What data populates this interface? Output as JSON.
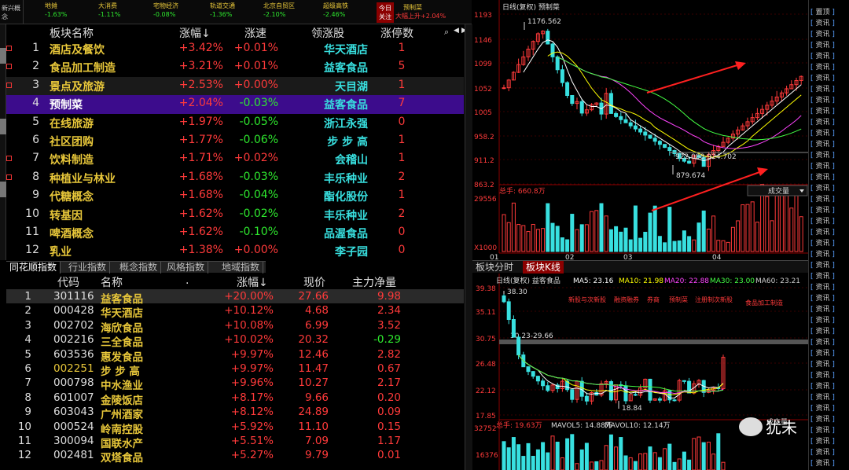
{
  "ticker": {
    "left_label": "新兴概念",
    "items": [
      {
        "name": "地摊",
        "value": "-1.63%",
        "dir": "dn"
      },
      {
        "name": "大消费",
        "value": "-1.11%",
        "dir": "dn"
      },
      {
        "name": "宅物经济",
        "value": "-0.08%",
        "dir": "dn"
      },
      {
        "name": "轨道交通",
        "value": "-1.36%",
        "dir": "dn"
      },
      {
        "name": "北京自贸区",
        "value": "-2.10%",
        "dir": "dn"
      },
      {
        "name": "超级高铁",
        "value": "-2.46%",
        "dir": "dn"
      },
      {
        "name": "预制菜",
        "value": "+2.04%",
        "dir": "up"
      }
    ],
    "today_label": "今日关注",
    "today_sub": "大幅上升"
  },
  "sector_table": {
    "headers": {
      "name": "板块名称",
      "pct": "涨幅↓",
      "speed": "涨速",
      "leader": "领涨股",
      "limit_up": "涨停数"
    },
    "rows": [
      {
        "no": "1",
        "name": "酒店及餐饮",
        "pct": "+3.42%",
        "speed": "+0.01%",
        "leader": "华天酒店",
        "limit_up": "1",
        "mark": true
      },
      {
        "no": "2",
        "name": "食品加工制造",
        "pct": "+3.21%",
        "speed": "+0.01%",
        "leader": "益客食品",
        "limit_up": "5",
        "mark": true
      },
      {
        "no": "3",
        "name": "景点及旅游",
        "pct": "+2.53%",
        "speed": "+0.00%",
        "leader": "天目湖",
        "limit_up": "1",
        "mark": true
      },
      {
        "no": "4",
        "name": "预制菜",
        "pct": "+2.04%",
        "speed": "-0.03%",
        "leader": "益客食品",
        "limit_up": "7",
        "mark": false
      },
      {
        "no": "5",
        "name": "在线旅游",
        "pct": "+1.97%",
        "speed": "-0.05%",
        "leader": "浙江永强",
        "limit_up": "0",
        "mark": false
      },
      {
        "no": "6",
        "name": "社区团购",
        "pct": "+1.77%",
        "speed": "-0.06%",
        "leader": "步 步 高",
        "limit_up": "1",
        "mark": false
      },
      {
        "no": "7",
        "name": "饮料制造",
        "pct": "+1.71%",
        "speed": "+0.02%",
        "leader": "会稽山",
        "limit_up": "1",
        "mark": true
      },
      {
        "no": "8",
        "name": "种植业与林业",
        "pct": "+1.68%",
        "speed": "-0.03%",
        "leader": "丰乐种业",
        "limit_up": "2",
        "mark": true
      },
      {
        "no": "9",
        "name": "代糖概念",
        "pct": "+1.68%",
        "speed": "-0.04%",
        "leader": "酯化股份",
        "limit_up": "1",
        "mark": false
      },
      {
        "no": "10",
        "name": "转基因",
        "pct": "+1.62%",
        "speed": "-0.02%",
        "leader": "丰乐种业",
        "limit_up": "2",
        "mark": false
      },
      {
        "no": "11",
        "name": "啤酒概念",
        "pct": "+1.62%",
        "speed": "-0.10%",
        "leader": "品渥食品",
        "limit_up": "0",
        "mark": false
      },
      {
        "no": "12",
        "name": "乳业",
        "pct": "+1.38%",
        "speed": "+0.00%",
        "leader": "李子园",
        "limit_up": "0",
        "mark": false
      }
    ]
  },
  "tabs": [
    "同花顺指数",
    "行业指数",
    "概念指数",
    "风格指数",
    "地域指数"
  ],
  "stock_table": {
    "headers": {
      "code": "代码",
      "name": "名称",
      "dot": ".",
      "pct": "涨幅↓",
      "price": "现价",
      "net": "主力净量"
    },
    "rows": [
      {
        "no": "1",
        "code": "301116",
        "name": "益客食品",
        "pct": "+20.00%",
        "price": "27.66",
        "net": "9.98",
        "net_dir": "up",
        "code_hl": false
      },
      {
        "no": "2",
        "code": "000428",
        "name": "华天酒店",
        "pct": "+10.12%",
        "price": "4.68",
        "net": "2.34",
        "net_dir": "up",
        "code_hl": false
      },
      {
        "no": "3",
        "code": "002702",
        "name": "海欣食品",
        "pct": "+10.08%",
        "price": "6.99",
        "net": "3.52",
        "net_dir": "up",
        "code_hl": false
      },
      {
        "no": "4",
        "code": "002216",
        "name": "三全食品",
        "pct": "+10.02%",
        "price": "20.32",
        "net": "-0.29",
        "net_dir": "dn",
        "code_hl": false
      },
      {
        "no": "5",
        "code": "603536",
        "name": "惠发食品",
        "pct": "+9.97%",
        "price": "12.46",
        "net": "2.82",
        "net_dir": "up",
        "code_hl": false
      },
      {
        "no": "6",
        "code": "002251",
        "name": "步 步 高",
        "pct": "+9.97%",
        "price": "11.47",
        "net": "0.67",
        "net_dir": "up",
        "code_hl": true
      },
      {
        "no": "7",
        "code": "000798",
        "name": "中水渔业",
        "pct": "+9.96%",
        "price": "10.27",
        "net": "2.17",
        "net_dir": "up",
        "code_hl": false
      },
      {
        "no": "8",
        "code": "601007",
        "name": "金陵饭店",
        "pct": "+8.17%",
        "price": "9.66",
        "net": "0.20",
        "net_dir": "up",
        "code_hl": false
      },
      {
        "no": "9",
        "code": "603043",
        "name": "广州酒家",
        "pct": "+8.12%",
        "price": "24.89",
        "net": "0.09",
        "net_dir": "up",
        "code_hl": false
      },
      {
        "no": "10",
        "code": "000524",
        "name": "岭南控股",
        "pct": "+5.92%",
        "price": "11.10",
        "net": "0.15",
        "net_dir": "up",
        "code_hl": false
      },
      {
        "no": "11",
        "code": "300094",
        "name": "国联水产",
        "pct": "+5.51%",
        "price": "7.09",
        "net": "1.17",
        "net_dir": "up",
        "code_hl": false
      },
      {
        "no": "12",
        "code": "002481",
        "name": "双塔食品",
        "pct": "+5.27%",
        "price": "9.79",
        "net": "0.01",
        "net_dir": "up",
        "code_hl": false
      }
    ]
  },
  "sector_chart": {
    "title": "日线(复权) 预制菜",
    "y_ticks": [
      "1193",
      "1146",
      "1099",
      "1052",
      "1005",
      "958.2",
      "911.2",
      "863.2"
    ],
    "high_label": "1176.562",
    "low_label": "879.674",
    "range_label": "922.088-924.702",
    "vol_label": "总手: 660.8万",
    "vol_ticks": [
      "29556",
      "X1000"
    ],
    "vol_dropdown": "成交量",
    "x_ticks": [
      "01",
      "02",
      "03",
      "04"
    ]
  },
  "kline_tabs": [
    "板块分时",
    "板块K线"
  ],
  "stock_chart": {
    "title": "日线(复权) 益客食品",
    "ma": [
      {
        "label": "MA5: 23.16",
        "color": "#ffffff"
      },
      {
        "label": "MA10: 21.98",
        "color": "#ffff00"
      },
      {
        "label": "MA20: 22.88",
        "color": "#ff44ff"
      },
      {
        "label": "MA30: 23.00",
        "color": "#44ff44"
      },
      {
        "label": "MA60: 23.21",
        "color": "#cccccc"
      }
    ],
    "tags": [
      "新股与次新股",
      "融资融券",
      "券商",
      "预制菜",
      "注册制次新股",
      "食品加工制造"
    ],
    "y_ticks": [
      "39.38",
      "35.11",
      "30.75",
      "26.48",
      "22.12",
      "17.85"
    ],
    "high_label": "38.30",
    "range_label": "30.23-29.66",
    "low_label": "18.84",
    "vol_label": "总手: 19.63万",
    "mavol5": "MAVOL5: 14.88万",
    "mavol10": "MAVOL10: 12.14万",
    "vol_ticks": [
      "32752",
      "16376"
    ],
    "vol_dropdown": "成交量"
  },
  "right_sidebar": [
    "置顶",
    "资讯",
    "资讯",
    "资讯",
    "资讯",
    "资讯",
    "资讯",
    "资讯",
    "资讯",
    "资讯",
    "资讯",
    "资讯",
    "资讯",
    "资讯",
    "资讯",
    "资讯",
    "资讯",
    "资讯",
    "资讯",
    "资讯",
    "资讯",
    "资讯",
    "资讯",
    "资讯",
    "资讯",
    "资讯",
    "资讯",
    "资讯",
    "资讯",
    "资讯",
    "资讯",
    "资讯",
    "资讯",
    "资讯",
    "资讯",
    "资讯",
    "资讯",
    "资讯",
    "资讯",
    "资讯",
    "资讯",
    "资讯"
  ],
  "watermark": "犹未"
}
